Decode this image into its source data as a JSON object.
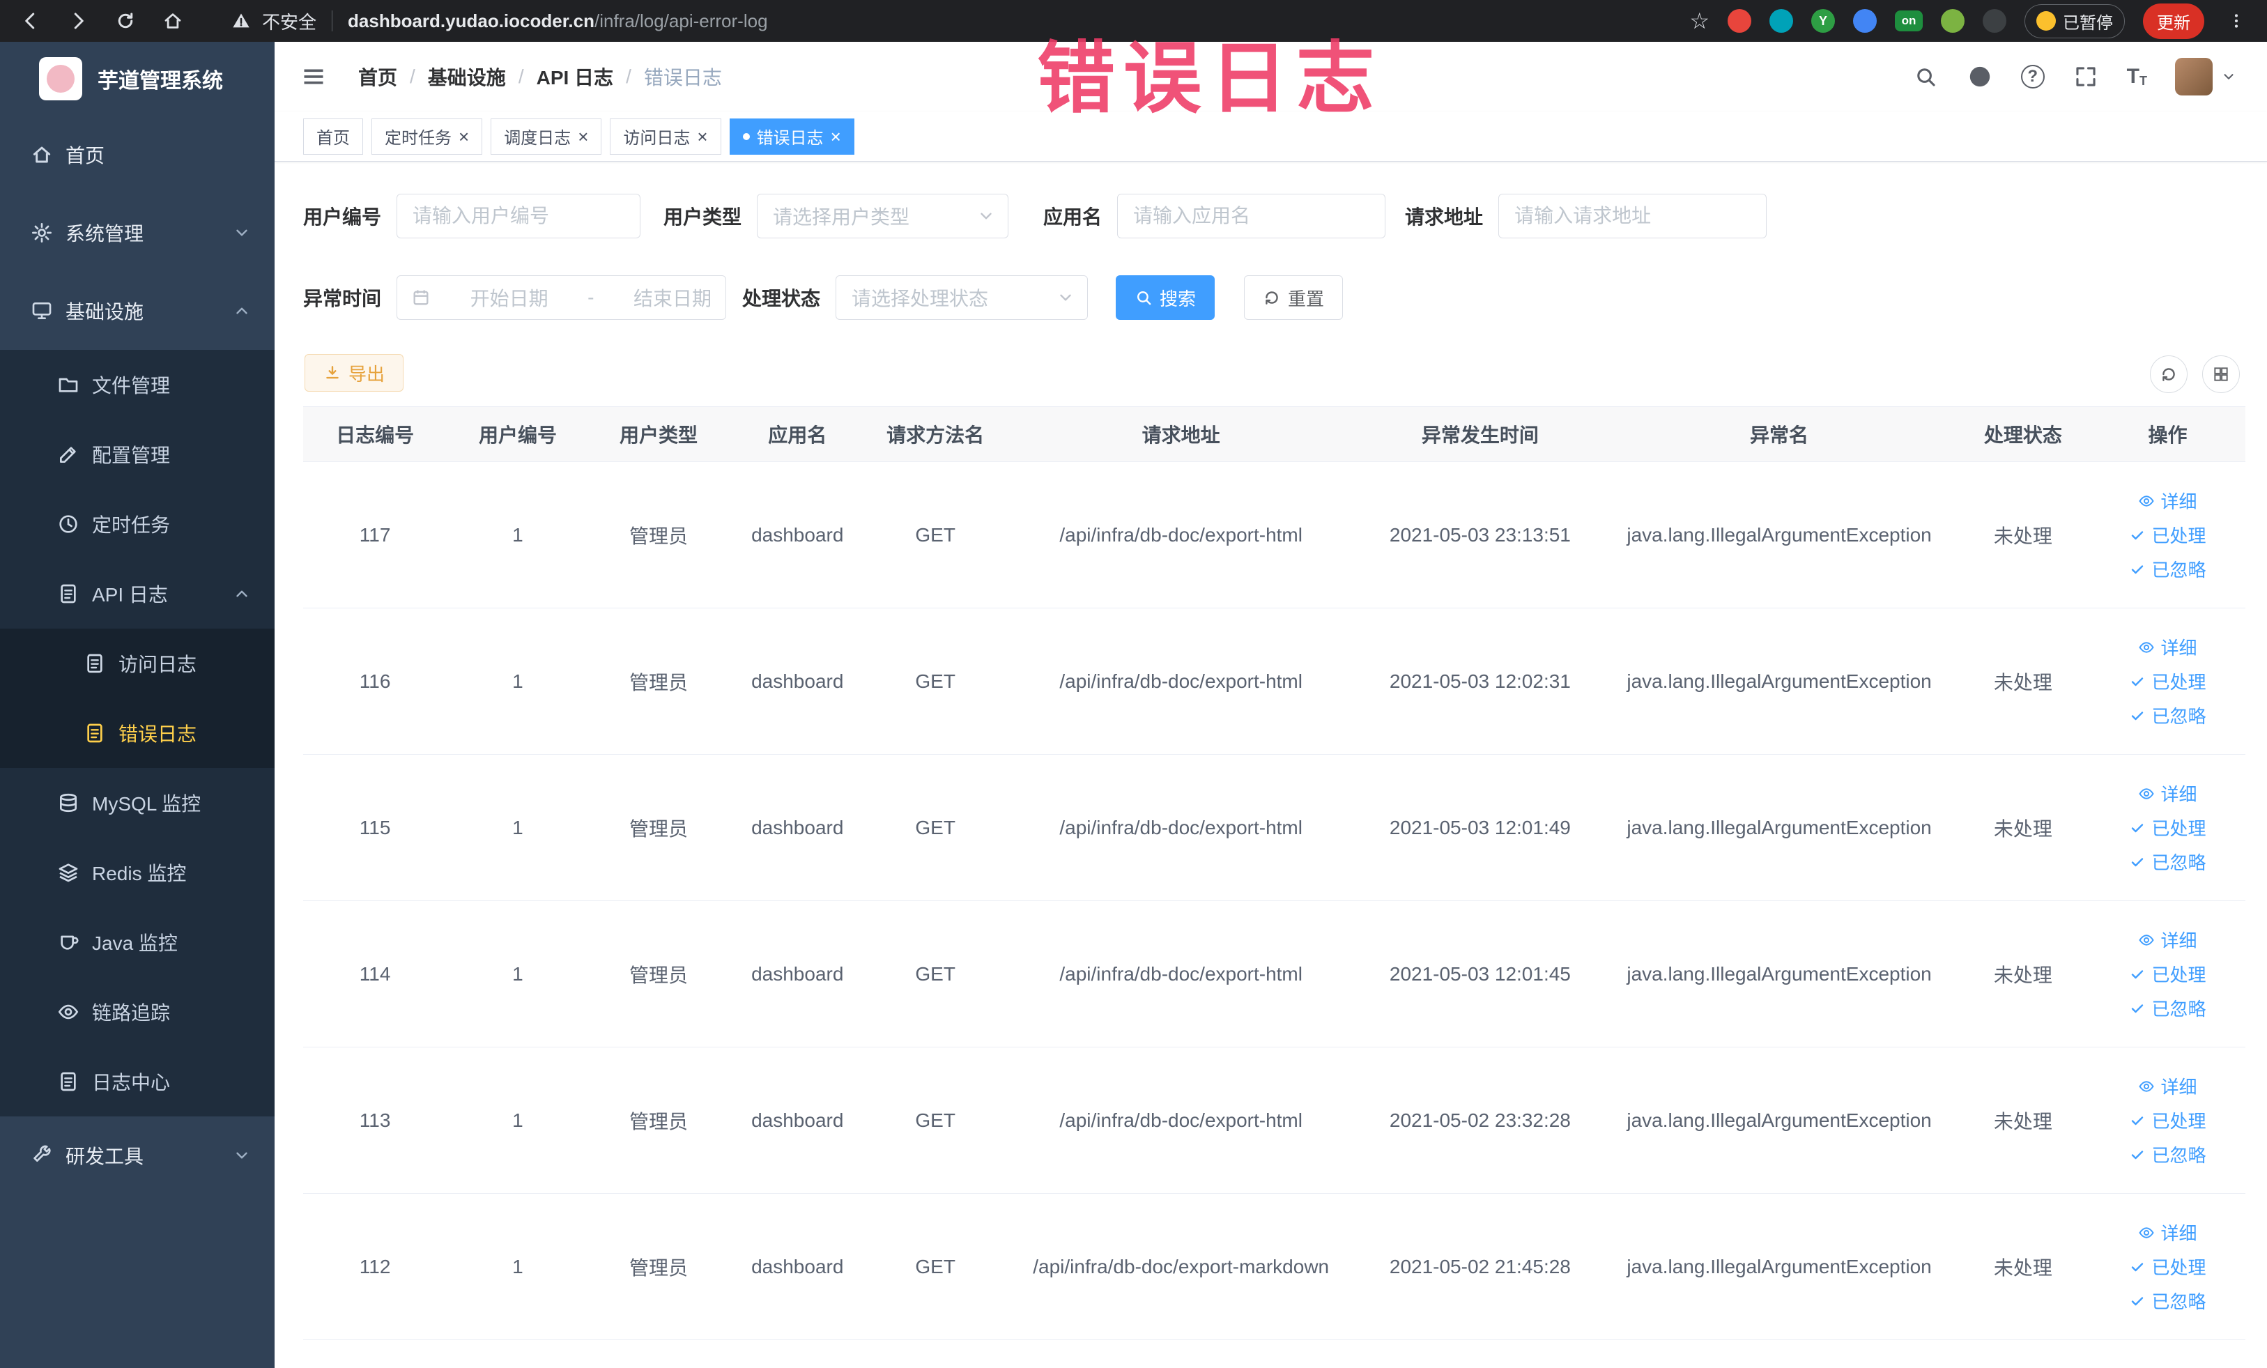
{
  "browser": {
    "security_label": "不安全",
    "url_domain": "dashboard.yudao.iocoder.cn",
    "url_path": "/infra/log/api-error-log",
    "extensions": {
      "y_label": "Y",
      "on_label": "on"
    },
    "paused_badge": "已暂停",
    "update_label": "更新"
  },
  "overlay": {
    "text": "错误日志"
  },
  "sidebar": {
    "logo_title": "芋道管理系统",
    "home": "首页",
    "system": "系统管理",
    "infra": "基础设施",
    "file": "文件管理",
    "config": "配置管理",
    "job": "定时任务",
    "api_log": "API 日志",
    "access_log": "访问日志",
    "error_log": "错误日志",
    "mysql": "MySQL 监控",
    "redis": "Redis 监控",
    "java": "Java 监控",
    "trace": "链路追踪",
    "log_center": "日志中心",
    "dev_tools": "研发工具"
  },
  "breadcrumb": {
    "items": [
      "首页",
      "基础设施",
      "API 日志",
      "错误日志"
    ],
    "separator": "/"
  },
  "tabs": [
    {
      "label": "首页"
    },
    {
      "label": "定时任务"
    },
    {
      "label": "调度日志"
    },
    {
      "label": "访问日志"
    },
    {
      "label": "错误日志"
    }
  ],
  "filters": {
    "user_id": {
      "label": "用户编号",
      "placeholder": "请输入用户编号"
    },
    "user_type": {
      "label": "用户类型",
      "placeholder": "请选择用户类型"
    },
    "app_name": {
      "label": "应用名",
      "placeholder": "请输入应用名"
    },
    "request_url": {
      "label": "请求地址",
      "placeholder": "请输入请求地址"
    },
    "exception_time": {
      "label": "异常时间",
      "start_placeholder": "开始日期",
      "separator": "-",
      "end_placeholder": "结束日期"
    },
    "process_status": {
      "label": "处理状态",
      "placeholder": "请选择处理状态"
    },
    "search_button": "搜索",
    "reset_button": "重置",
    "export_button": "导出"
  },
  "table": {
    "headers": [
      "日志编号",
      "用户编号",
      "用户类型",
      "应用名",
      "请求方法名",
      "请求地址",
      "异常发生时间",
      "异常名",
      "处理状态",
      "操作"
    ],
    "actions": {
      "detail": "详细",
      "processed": "已处理",
      "ignored": "已忽略"
    },
    "rows": [
      {
        "id": "117",
        "user_id": "1",
        "user_type": "管理员",
        "app": "dashboard",
        "method": "GET",
        "url": "/api/infra/db-doc/export-html",
        "time": "2021-05-03 23:13:51",
        "exception": "java.lang.IllegalArgumentException",
        "status": "未处理"
      },
      {
        "id": "116",
        "user_id": "1",
        "user_type": "管理员",
        "app": "dashboard",
        "method": "GET",
        "url": "/api/infra/db-doc/export-html",
        "time": "2021-05-03 12:02:31",
        "exception": "java.lang.IllegalArgumentException",
        "status": "未处理"
      },
      {
        "id": "115",
        "user_id": "1",
        "user_type": "管理员",
        "app": "dashboard",
        "method": "GET",
        "url": "/api/infra/db-doc/export-html",
        "time": "2021-05-03 12:01:49",
        "exception": "java.lang.IllegalArgumentException",
        "status": "未处理"
      },
      {
        "id": "114",
        "user_id": "1",
        "user_type": "管理员",
        "app": "dashboard",
        "method": "GET",
        "url": "/api/infra/db-doc/export-html",
        "time": "2021-05-03 12:01:45",
        "exception": "java.lang.IllegalArgumentException",
        "status": "未处理"
      },
      {
        "id": "113",
        "user_id": "1",
        "user_type": "管理员",
        "app": "dashboard",
        "method": "GET",
        "url": "/api/infra/db-doc/export-html",
        "time": "2021-05-02 23:32:28",
        "exception": "java.lang.IllegalArgumentException",
        "status": "未处理"
      },
      {
        "id": "112",
        "user_id": "1",
        "user_type": "管理员",
        "app": "dashboard",
        "method": "GET",
        "url": "/api/infra/db-doc/export-markdown",
        "time": "2021-05-02 21:45:28",
        "exception": "java.lang.IllegalArgumentException",
        "status": "未处理"
      }
    ]
  },
  "icons": {
    "close": "×",
    "star": "☆",
    "question": "?",
    "font_size_large": "T",
    "font_size_small": "T"
  },
  "colors": {
    "accent": "#409eff",
    "sidebar_bg": "#304156",
    "submenu_bg": "#1f2d3d",
    "active_menu": "#ffd04b",
    "warn_button": "#e6a23c",
    "overlay_red": "#ee3b66"
  }
}
